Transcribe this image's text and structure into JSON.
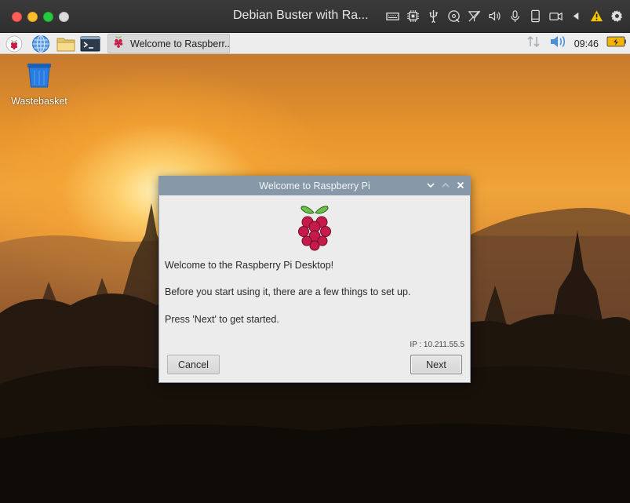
{
  "vm": {
    "title": "Debian Buster with Ra...",
    "icons": [
      "keyboard-icon",
      "cpu-icon",
      "usb-icon",
      "cd-icon",
      "network-off-icon",
      "speaker-icon",
      "microphone-icon",
      "phone-icon",
      "camera-icon",
      "arrow-left-icon",
      "warning-icon",
      "settings-gear-icon"
    ]
  },
  "panel": {
    "launchers": [
      "raspberry-menu-icon",
      "web-browser-icon",
      "file-manager-icon",
      "terminal-icon"
    ],
    "task": {
      "label": "Welcome to Raspberr..."
    },
    "clock": "09:46"
  },
  "desktop": {
    "icons": [
      {
        "label": "Wastebasket"
      }
    ]
  },
  "dialog": {
    "title": "Welcome to Raspberry Pi",
    "line1": "Welcome to the Raspberry Pi Desktop!",
    "line2": "Before you start using it, there are a few things to set up.",
    "line3": "Press 'Next' to get started.",
    "ip": "IP : 10.211.55.5",
    "cancel_label": "Cancel",
    "next_label": "Next"
  },
  "colors": {
    "panel_bg": "#ededed",
    "dialog_title_bg": "#8799a8",
    "raspberry_red": "#c51a4a",
    "leaf_green": "#6cc04a",
    "warning_yellow": "#f5c400"
  }
}
